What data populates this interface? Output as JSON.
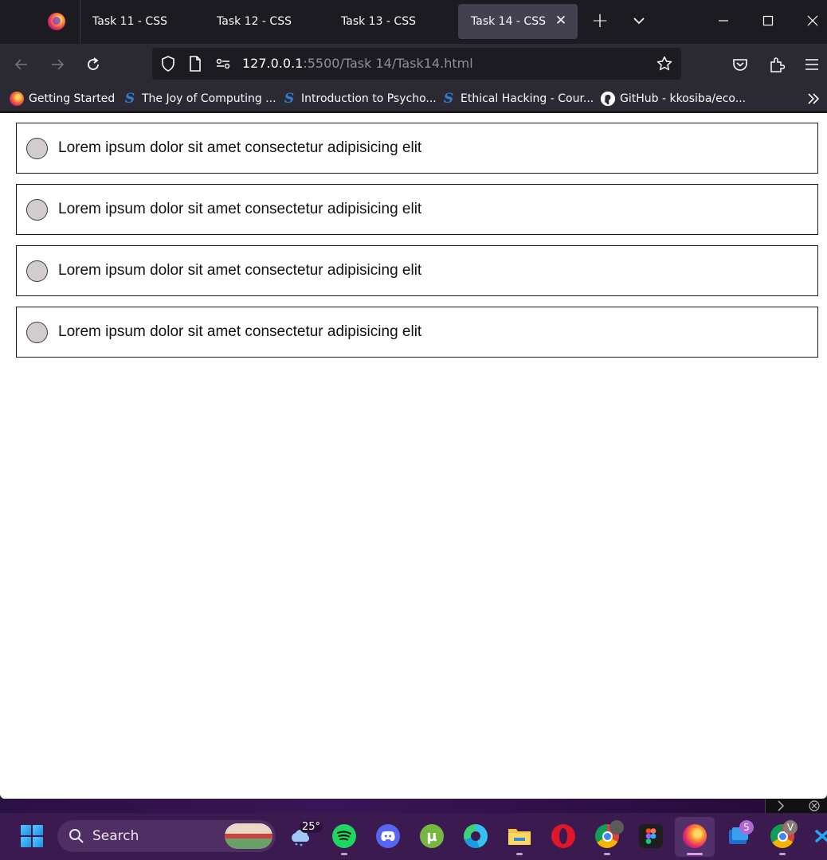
{
  "browser": {
    "tabs": [
      {
        "title": "Task 11 - CSS",
        "active": false
      },
      {
        "title": "Task 12 - CSS",
        "active": false
      },
      {
        "title": "Task 13 - CSS",
        "active": false
      },
      {
        "title": "Task 14 - CSS",
        "active": true
      }
    ],
    "url": {
      "host": "127.0.0.1",
      "rest": ":5500/Task 14/Task14.html"
    },
    "bookmarks": [
      {
        "label": "Getting Started",
        "icon": "firefox-icon"
      },
      {
        "label": "The Joy of Computing ...",
        "icon": "swayam-icon"
      },
      {
        "label": "Introduction to Psycho...",
        "icon": "swayam-icon"
      },
      {
        "label": "Ethical Hacking - Cour...",
        "icon": "swayam-icon"
      },
      {
        "label": "GitHub - kkosiba/eco...",
        "icon": "github-icon"
      }
    ]
  },
  "page": {
    "options": [
      {
        "label": "Lorem ipsum dolor sit amet consectetur adipisicing elit"
      },
      {
        "label": "Lorem ipsum dolor sit amet consectetur adipisicing elit"
      },
      {
        "label": "Lorem ipsum dolor sit amet consectetur adipisicing elit"
      },
      {
        "label": "Lorem ipsum dolor sit amet consectetur adipisicing elit"
      }
    ]
  },
  "taskbar": {
    "search_label": "Search",
    "weather_temp": "25°",
    "mail_badge": "5",
    "chrome_profile_initial": "V",
    "apps": [
      "weather-icon",
      "spotify-icon",
      "discord-icon",
      "utorrent-icon",
      "edge-icon",
      "file-explorer-icon",
      "opera-icon",
      "chrome-icon",
      "figma-icon",
      "firefox-icon",
      "mail-icon",
      "chrome-icon",
      "vscode-icon"
    ]
  },
  "colors": {
    "tabstrip": "#1c1b22",
    "toolbar": "#2b2a33",
    "active_tab": "#42414d",
    "radio_fill": "#d2cccd",
    "taskbar": "#3b1a4f"
  }
}
